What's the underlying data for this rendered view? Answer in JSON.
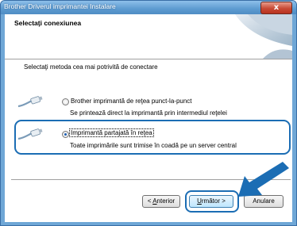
{
  "window": {
    "title": "Brother Driverul imprimantei Instalare",
    "close_glyph": "x"
  },
  "header": {
    "title": "Selectaţi conexiunea"
  },
  "instruction": "Selectaţi metoda cea mai potrivită de conectare",
  "options": [
    {
      "label": "Brother imprimantă de reţea punct-la-punct",
      "description": "Se printează direct la imprimantă prin intermediul reţelei",
      "selected": false,
      "icon": "network-cable-icon"
    },
    {
      "label": "Imprimantă partajată în reţea",
      "description": "Toate imprimările sunt trimise în coadă pe un server central",
      "selected": true,
      "icon": "network-cable-icon"
    }
  ],
  "buttons": {
    "back_accel": "A",
    "back_rest": "nterior",
    "back_prefix": "< ",
    "next_accel": "U",
    "next_rest": "rmător",
    "next_suffix": " >",
    "cancel": "Anulare"
  },
  "colors": {
    "highlight": "#1b6db4",
    "title_bar": "#5d9bd0",
    "arrow": "#1b6db4"
  }
}
